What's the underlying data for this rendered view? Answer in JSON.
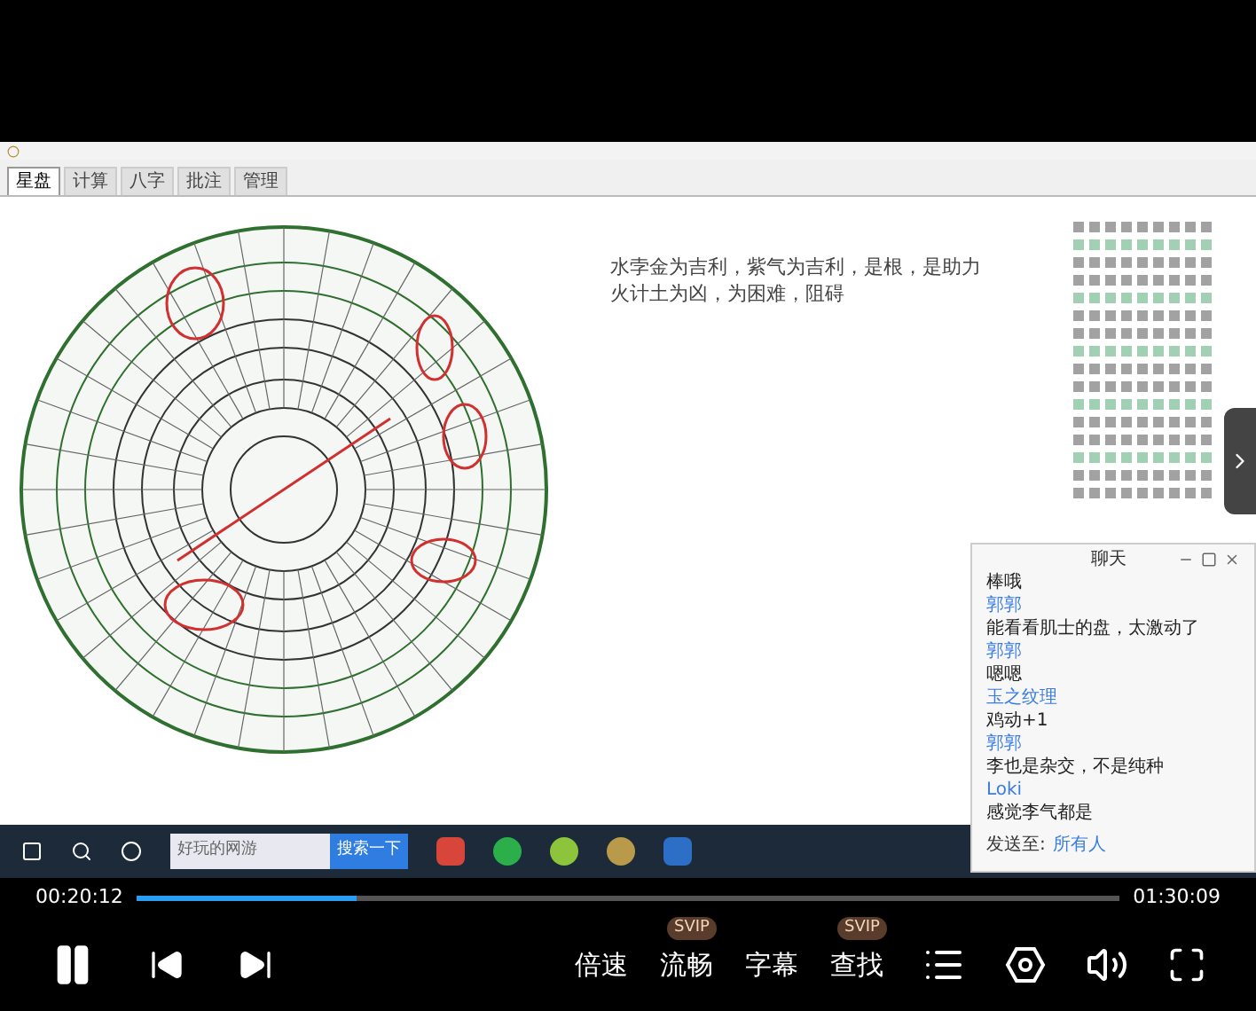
{
  "app": {
    "tabs": [
      {
        "label": "星盘",
        "selected": true
      },
      {
        "label": "计算",
        "selected": false
      },
      {
        "label": "八字",
        "selected": false
      },
      {
        "label": "批注",
        "selected": false
      },
      {
        "label": "管理",
        "selected": false
      }
    ],
    "lines": [
      "水孛金为吉利，紫气为吉利，是根，是助力",
      "火计土为凶，为困难，阻碍"
    ]
  },
  "chat": {
    "title": "聊天",
    "messages": [
      {
        "kind": "text",
        "text": "棒哦"
      },
      {
        "kind": "name",
        "text": "郭郭"
      },
      {
        "kind": "text",
        "text": "能看看肌士的盘，太激动了"
      },
      {
        "kind": "name",
        "text": "郭郭"
      },
      {
        "kind": "text",
        "text": "嗯嗯"
      },
      {
        "kind": "name",
        "text": "玉之纹理"
      },
      {
        "kind": "text",
        "text": "鸡动+1"
      },
      {
        "kind": "name",
        "text": "郭郭"
      },
      {
        "kind": "text",
        "text": "李也是杂交，不是纯种"
      },
      {
        "kind": "name",
        "text": "Loki"
      },
      {
        "kind": "text",
        "text": "感觉李气都是"
      }
    ],
    "send_label": "发送至:",
    "recipient": "所有人"
  },
  "taskbar": {
    "search_placeholder": "好玩的网游",
    "search_button": "搜索一下"
  },
  "player": {
    "elapsed": "00:20:12",
    "total": "01:30:09",
    "level": 0.224,
    "options": [
      {
        "label": "倍速"
      },
      {
        "label": "流畅",
        "badge": "SVIP"
      },
      {
        "label": "字幕"
      },
      {
        "label": "查找",
        "badge": "SVIP"
      }
    ]
  }
}
